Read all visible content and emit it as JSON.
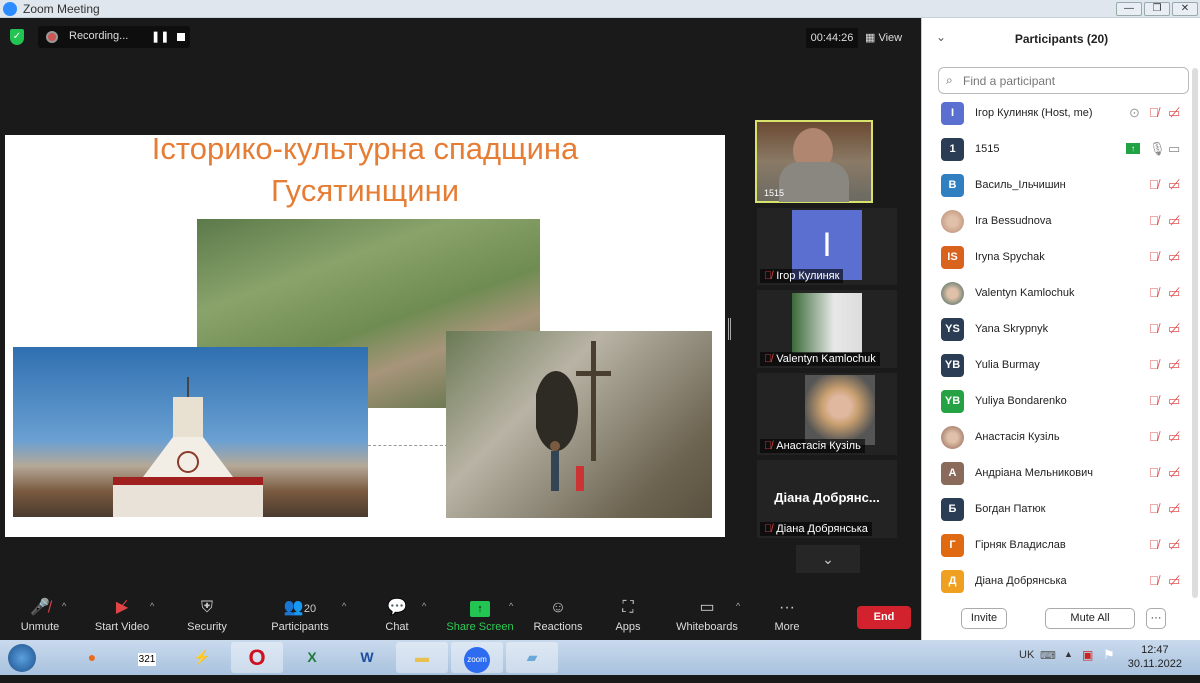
{
  "window": {
    "title": "Zoom Meeting",
    "minimize": "—",
    "restore": "❐",
    "close": "✕"
  },
  "recording": {
    "label": "Recording...",
    "pause": "❚❚"
  },
  "timer": "00:44:26",
  "view_label": "View",
  "slide": {
    "title_line1": "Історико-культурна спадщина",
    "title_line2": "Гусятинщини"
  },
  "videos": [
    {
      "label": "1515"
    },
    {
      "label": "Ігор Кулиняк",
      "avatar": "I"
    },
    {
      "label": "Valentyn Kamlochuk"
    },
    {
      "label": "Анастасія Кузіль"
    },
    {
      "label": "Діана Добрянська",
      "display": "Діана Добрянс..."
    }
  ],
  "panel": {
    "title": "Participants (20)",
    "search_placeholder": "Find a participant",
    "invite": "Invite",
    "mute_all": "Mute All",
    "more": "···",
    "participants": [
      {
        "name": "Ігор Кулиняк (Host, me)",
        "initial": "I",
        "color": "#5b6fd1"
      },
      {
        "name": "1515",
        "initial": "1",
        "color": "#2b3d55"
      },
      {
        "name": "Василь_Ільчишин",
        "initial": "В",
        "color": "#2f7fc1"
      },
      {
        "name": "Ira Bessudnova",
        "initial": "",
        "color": "#c9a08a"
      },
      {
        "name": "Iryna Spychak",
        "initial": "IS",
        "color": "#d9621c"
      },
      {
        "name": "Valentyn Kamlochuk",
        "initial": "",
        "color": "#7c8a7a"
      },
      {
        "name": "Yana Skrypnyk",
        "initial": "YS",
        "color": "#2b3d55"
      },
      {
        "name": "Yulia Burmay",
        "initial": "YB",
        "color": "#2b3d55"
      },
      {
        "name": "Yuliya Bondarenko",
        "initial": "YB",
        "color": "#25a244"
      },
      {
        "name": "Анастасія Кузіль",
        "initial": "",
        "color": "#b08a78"
      },
      {
        "name": "Андріана Мельникович",
        "initial": "А",
        "color": "#8a6a5a"
      },
      {
        "name": "Богдан Патюк",
        "initial": "Б",
        "color": "#2b3d55"
      },
      {
        "name": "Гірняк Владислав",
        "initial": "Г",
        "color": "#e06a12"
      },
      {
        "name": "Діана Добрянська",
        "initial": "Д",
        "color": "#f0a020"
      }
    ]
  },
  "toolbar": {
    "unmute": "Unmute",
    "start_video": "Start Video",
    "security": "Security",
    "participants": "Participants",
    "participants_count": "20",
    "chat": "Chat",
    "share_screen": "Share Screen",
    "reactions": "Reactions",
    "apps": "Apps",
    "whiteboards": "Whiteboards",
    "more": "More",
    "end": "End"
  },
  "taskbar": {
    "language": "UK",
    "time": "12:47",
    "date": "30.11.2022",
    "zoom_label": "zoom"
  }
}
